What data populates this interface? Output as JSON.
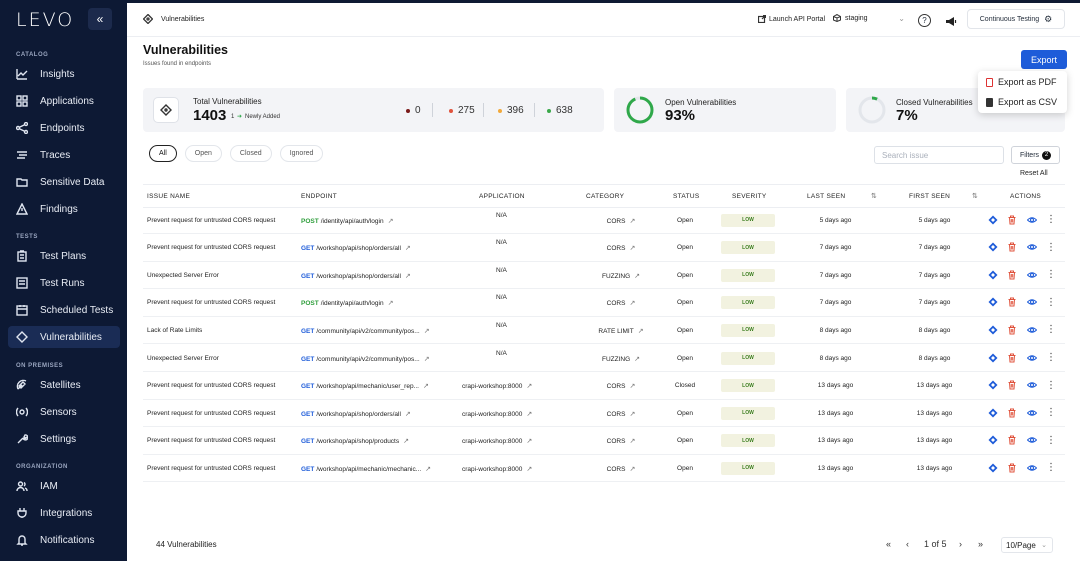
{
  "sidebar": {
    "logo": "LEVO",
    "sections": {
      "catalog": "CATALOG",
      "tests": "TESTS",
      "on_premises": "ON PREMISES",
      "organization": "ORGANIZATION"
    },
    "items": [
      {
        "label": "Insights"
      },
      {
        "label": "Applications"
      },
      {
        "label": "Endpoints"
      },
      {
        "label": "Traces"
      },
      {
        "label": "Sensitive Data"
      },
      {
        "label": "Findings"
      },
      {
        "label": "Test Plans"
      },
      {
        "label": "Test Runs"
      },
      {
        "label": "Scheduled Tests"
      },
      {
        "label": "Vulnerabilities"
      },
      {
        "label": "Satellites"
      },
      {
        "label": "Sensors"
      },
      {
        "label": "Settings"
      },
      {
        "label": "IAM"
      },
      {
        "label": "Integrations"
      },
      {
        "label": "Notifications"
      }
    ]
  },
  "topbar": {
    "breadcrumb": "Vulnerabilities",
    "launch_portal": "Launch API Portal",
    "environment": "staging",
    "continuous_testing": "Continuous Testing"
  },
  "header": {
    "title": "Vulnerabilities",
    "subtitle": "Issues found in endpoints",
    "export_label": "Export",
    "export_pdf": "Export as PDF",
    "export_csv": "Export as CSV"
  },
  "stats": {
    "total_label": "Total Vulnerabilities",
    "total_value": "1403",
    "newly_added_count": "1",
    "newly_added_label": "Newly Added",
    "severity_counts": [
      {
        "value": "0",
        "color": "#7a1a1a"
      },
      {
        "value": "275",
        "color": "#e0533d"
      },
      {
        "value": "396",
        "color": "#f2a93b"
      },
      {
        "value": "638",
        "color": "#3aa84a"
      }
    ],
    "open_label": "Open Vulnerabilities",
    "open_value": "93%",
    "open_fraction": 0.93,
    "closed_label": "Closed Vulnerabilities",
    "closed_value": "7%",
    "closed_fraction": 0.07
  },
  "filters": {
    "tabs": [
      "All",
      "Open",
      "Closed",
      "Ignored"
    ],
    "search_placeholder": "Search issue",
    "filters_label": "Filters",
    "filters_count": "2",
    "reset_label": "Reset All"
  },
  "table": {
    "headers": {
      "issue": "ISSUE NAME",
      "endpoint": "ENDPOINT",
      "application": "APPLICATION",
      "category": "CATEGORY",
      "status": "STATUS",
      "severity": "SEVERITY",
      "last_seen": "LAST SEEN",
      "first_seen": "FIRST SEEN",
      "actions": "ACTIONS"
    },
    "rows": [
      {
        "issue": "Prevent request for untrusted CORS request",
        "method": "POST",
        "path": "/identity/api/auth/login",
        "application": "N/A",
        "category": "CORS",
        "status": "Open",
        "severity": "LOW",
        "last_seen": "5 days ago",
        "first_seen": "5 days ago"
      },
      {
        "issue": "Prevent request for untrusted CORS request",
        "method": "GET",
        "path": "/workshop/api/shop/orders/all",
        "application": "N/A",
        "category": "CORS",
        "status": "Open",
        "severity": "LOW",
        "last_seen": "7 days ago",
        "first_seen": "7 days ago"
      },
      {
        "issue": "Unexpected Server Error",
        "method": "GET",
        "path": "/workshop/api/shop/orders/all",
        "application": "N/A",
        "category": "FUZZING",
        "status": "Open",
        "severity": "LOW",
        "last_seen": "7 days ago",
        "first_seen": "7 days ago"
      },
      {
        "issue": "Prevent request for untrusted CORS request",
        "method": "POST",
        "path": "/identity/api/auth/login",
        "application": "N/A",
        "category": "CORS",
        "status": "Open",
        "severity": "LOW",
        "last_seen": "7 days ago",
        "first_seen": "7 days ago"
      },
      {
        "issue": "Lack of Rate Limits",
        "method": "GET",
        "path": "/community/api/v2/community/pos...",
        "application": "N/A",
        "category": "RATE LIMIT",
        "status": "Open",
        "severity": "LOW",
        "last_seen": "8 days ago",
        "first_seen": "8 days ago"
      },
      {
        "issue": "Unexpected Server Error",
        "method": "GET",
        "path": "/community/api/v2/community/pos...",
        "application": "N/A",
        "category": "FUZZING",
        "status": "Open",
        "severity": "LOW",
        "last_seen": "8 days ago",
        "first_seen": "8 days ago"
      },
      {
        "issue": "Prevent request for untrusted CORS request",
        "method": "GET",
        "path": "/workshop/api/mechanic/user_rep...",
        "application": "crapi-workshop:8000",
        "category": "CORS",
        "status": "Closed",
        "severity": "LOW",
        "last_seen": "13 days ago",
        "first_seen": "13 days ago"
      },
      {
        "issue": "Prevent request for untrusted CORS request",
        "method": "GET",
        "path": "/workshop/api/shop/orders/all",
        "application": "crapi-workshop:8000",
        "category": "CORS",
        "status": "Open",
        "severity": "LOW",
        "last_seen": "13 days ago",
        "first_seen": "13 days ago"
      },
      {
        "issue": "Prevent request for untrusted CORS request",
        "method": "GET",
        "path": "/workshop/api/shop/products",
        "application": "crapi-workshop:8000",
        "category": "CORS",
        "status": "Open",
        "severity": "LOW",
        "last_seen": "13 days ago",
        "first_seen": "13 days ago"
      },
      {
        "issue": "Prevent request for untrusted CORS request",
        "method": "GET",
        "path": "/workshop/api/mechanic/mechanic...",
        "application": "crapi-workshop:8000",
        "category": "CORS",
        "status": "Open",
        "severity": "LOW",
        "last_seen": "13 days ago",
        "first_seen": "13 days ago"
      }
    ]
  },
  "footer": {
    "total": "44 Vulnerabilities",
    "page_label": "1 of 5",
    "page_size": "10/Page"
  },
  "colors": {
    "accent": "#1e5cd9",
    "post": "#2f9e3c",
    "get": "#1e5cd9",
    "ring_green": "#2fa84a",
    "low_text": "#3a7d1e"
  }
}
